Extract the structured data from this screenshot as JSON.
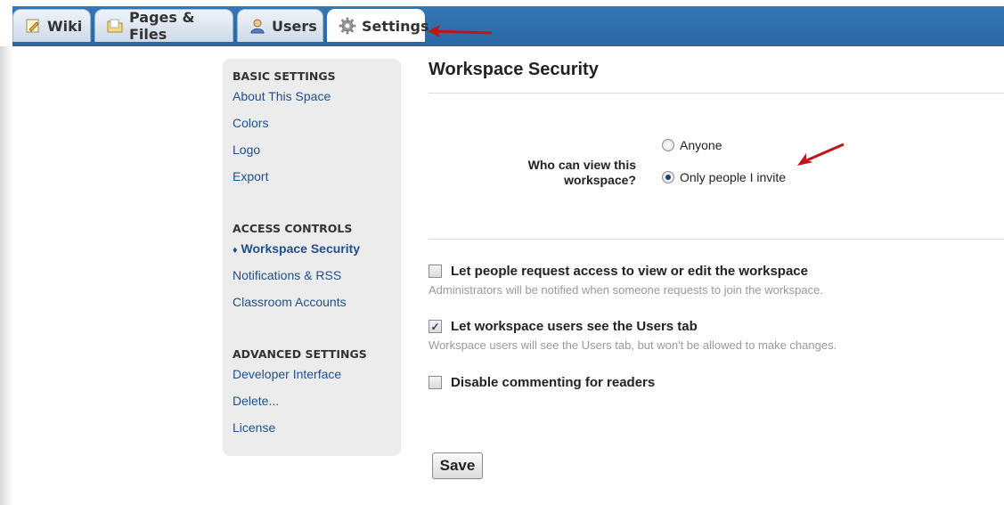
{
  "tabs": [
    {
      "label": "Wiki",
      "icon": "edit-page-icon"
    },
    {
      "label": "Pages & Files",
      "icon": "folder-icon"
    },
    {
      "label": "Users",
      "icon": "user-icon"
    },
    {
      "label": "Settings",
      "icon": "gear-icon",
      "active": true
    }
  ],
  "sidebar": {
    "basic_heading": "BASIC SETTINGS",
    "basic_items": [
      "About This Space",
      "Colors",
      "Logo",
      "Export"
    ],
    "access_heading": "ACCESS CONTROLS",
    "access_items": [
      "Workspace Security",
      "Notifications & RSS",
      "Classroom Accounts"
    ],
    "current_marker": "♦",
    "advanced_heading": "ADVANCED SETTINGS",
    "advanced_items": [
      "Developer Interface",
      "Delete...",
      "License"
    ]
  },
  "main": {
    "title": "Workspace Security",
    "who_label_line1": "Who can view this",
    "who_label_line2": "workspace?",
    "radio_anyone": "Anyone",
    "radio_invite": "Only people I invite",
    "selected_radio": "Only people I invite",
    "options": [
      {
        "label": "Let people request access to view or edit the workspace",
        "checked": false,
        "help": "Administrators will be notified when someone requests to join the workspace."
      },
      {
        "label": "Let workspace users see the Users tab",
        "checked": true,
        "help": "Workspace users will see the Users tab, but won't be allowed to make changes."
      },
      {
        "label": "Disable commenting for readers",
        "checked": false,
        "help": ""
      }
    ],
    "save_label": "Save"
  },
  "colors": {
    "tabbar": "#2a67a4",
    "link": "#1f4f8a",
    "annotation_arrow": "#c0141b"
  }
}
